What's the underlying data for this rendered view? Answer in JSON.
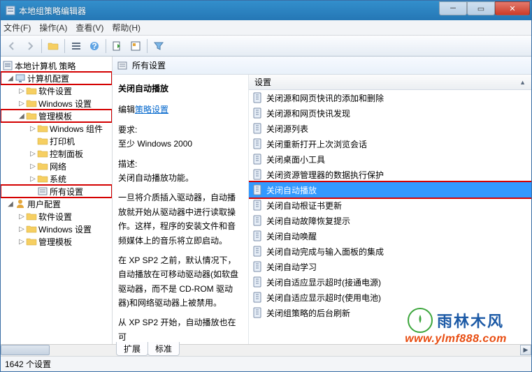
{
  "window": {
    "title": "本地组策略编辑器"
  },
  "menu": [
    "文件(F)",
    "操作(A)",
    "查看(V)",
    "帮助(H)"
  ],
  "tree": {
    "root": "本地计算机 策略",
    "computer": "计算机配置",
    "computer_children": {
      "software": "软件设置",
      "windows": "Windows 设置",
      "templates": "管理模板",
      "templates_children": {
        "winComp": "Windows 组件",
        "printer": "打印机",
        "controlPanel": "控制面板",
        "network": "网络",
        "system": "系统",
        "allSettings": "所有设置"
      }
    },
    "user": "用户配置",
    "user_children": {
      "software": "软件设置",
      "windows": "Windows 设置",
      "templates": "管理模板"
    }
  },
  "breadcrumb": "所有设置",
  "detail": {
    "title": "关闭自动播放",
    "editLabel": "编辑",
    "editLink": "策略设置",
    "reqLabel": "要求:",
    "reqValue": "至少 Windows 2000",
    "descLabel": "描述:",
    "descLine1": "关闭自动播放功能。",
    "descPara2": "一旦将介质插入驱动器，自动播放就开始从驱动器中进行读取操作。这样，程序的安装文件和音频媒体上的音乐将立即启动。",
    "descPara3": "在 XP SP2 之前，默认情况下，自动播放在可移动驱动器(如软盘驱动器，而不是 CD-ROM 驱动器)和网络驱动器上被禁用。",
    "descPara4": "从 XP SP2 开始，自动播放也在可"
  },
  "columnHeader": "设置",
  "list": [
    "关闭源和网页快讯的添加和删除",
    "关闭源和网页快讯发现",
    "关闭源列表",
    "关闭重新打开上次浏览会话",
    "关闭桌面小工具",
    "关闭资源管理器的数据执行保护",
    "关闭自动播放",
    "关闭自动根证书更新",
    "关闭自动故障恢复提示",
    "关闭自动唤醒",
    "关闭自动完成与输入面板的集成",
    "关闭自动学习",
    "关闭自适应显示超时(接通电源)",
    "关闭自适应显示超时(使用电池)",
    "关闭组策略的后台刷新"
  ],
  "selectedIndex": 6,
  "tabs": [
    "扩展",
    "标准"
  ],
  "status": "1642 个设置",
  "watermark": {
    "brand": "雨林木风",
    "url": "www.ylmf888.com"
  }
}
